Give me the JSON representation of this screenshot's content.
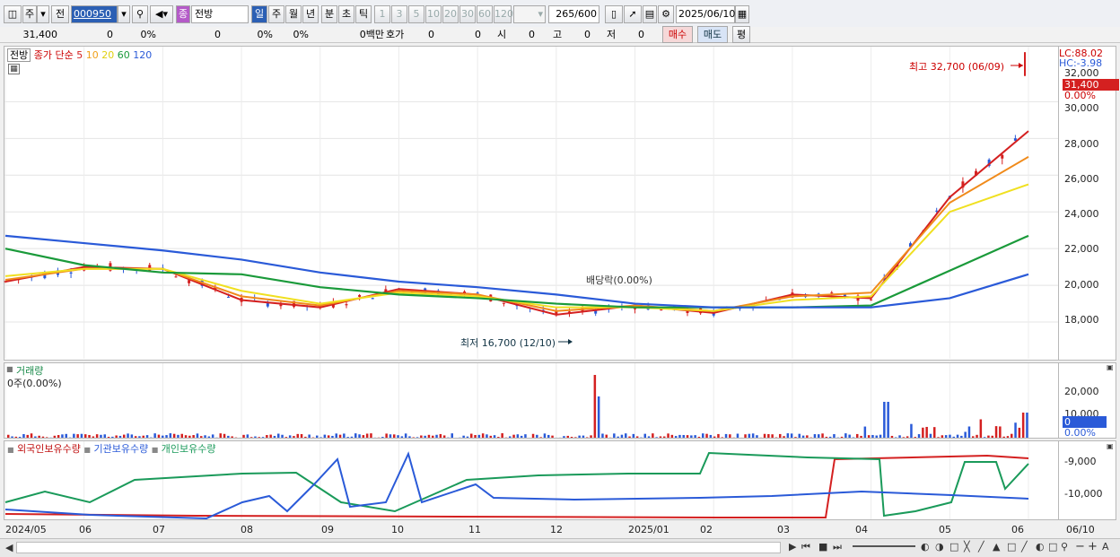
{
  "toolbar": {
    "type_label": "주",
    "prefix_label": "전",
    "code_value": "000950",
    "sector_badge": "종",
    "stock_name": "전방",
    "periods": [
      "일",
      "주",
      "월",
      "년",
      "분",
      "초",
      "틱"
    ],
    "intervals": [
      "1",
      "3",
      "5",
      "10",
      "20",
      "30",
      "60",
      "120"
    ],
    "count_value": "265",
    "count_max": "/600",
    "date_value": "2025/06/10"
  },
  "quote": {
    "price": "31,400",
    "change": "0",
    "change_pct": "0%",
    "volume": "0",
    "volume_pct": "0%",
    "turnover_pct": "0%",
    "amount": "0백만",
    "hoga_label": "호가",
    "hoga1": "0",
    "hoga2": "0",
    "open_label": "시",
    "open_value": "0",
    "high_label": "고",
    "high_value": "0",
    "low_label": "저",
    "low_value": "0",
    "buy_label": "매수",
    "sell_label": "매도",
    "avg_label": "평"
  },
  "price_panel": {
    "name_tag": "전방",
    "ma_label": "종가 단순",
    "ma_periods": [
      "5",
      "10",
      "20",
      "60",
      "120"
    ],
    "ma_colors": [
      "#d42020",
      "#f08a1a",
      "#f0e020",
      "#1a9a3a",
      "#2a5ad8"
    ],
    "lc_label": "LC:88.02",
    "hc_label": "HC:-3.98",
    "max_label": "32,000",
    "current_price": "31,400",
    "current_pct": "0.00%",
    "y_ticks": [
      "30,000",
      "28,000",
      "26,000",
      "24,000",
      "22,000",
      "20,000",
      "18,000"
    ],
    "high_annotation": "최고 32,700 (06/09)",
    "low_annotation": "최저 16,700 (12/10)",
    "dividend_annotation": "배당락(0.00%)"
  },
  "volume_panel": {
    "title": "거래량",
    "value": "0주(0.00%)",
    "y_ticks": [
      "20,000",
      "10,000"
    ],
    "current": "0",
    "current_pct": "0.00%"
  },
  "holding_panel": {
    "legend": [
      "외국인보유수량",
      "기관보유수량",
      "개인보유수량"
    ],
    "legend_colors": [
      "#d42020",
      "#2a5ad8",
      "#1a9a5a"
    ],
    "y_ticks": [
      "-9,000",
      "-10,000"
    ]
  },
  "x_labels": [
    "2024/05",
    "06",
    "07",
    "08",
    "09",
    "10",
    "11",
    "12",
    "2025/01",
    "02",
    "03",
    "04",
    "05",
    "06"
  ],
  "x_right_label": "06/10",
  "chart_data": {
    "type": "line",
    "title": "전방",
    "x": [
      "2024/05",
      "06",
      "07",
      "08",
      "09",
      "10",
      "11",
      "12",
      "2025/01",
      "02",
      "03",
      "04",
      "05",
      "06"
    ],
    "series": [
      {
        "name": "5",
        "values": [
          20200,
          21000,
          20900,
          19200,
          18800,
          19800,
          19500,
          18400,
          18900,
          18500,
          19500,
          19300,
          24800,
          28400
        ]
      },
      {
        "name": "10",
        "values": [
          20300,
          20900,
          20900,
          19400,
          18900,
          19700,
          19500,
          18600,
          18900,
          18600,
          19400,
          19600,
          24500,
          27000
        ]
      },
      {
        "name": "20",
        "values": [
          20500,
          20900,
          20900,
          19700,
          19000,
          19600,
          19400,
          18800,
          18800,
          18600,
          19200,
          19400,
          24000,
          25500
        ]
      },
      {
        "name": "60",
        "values": [
          22000,
          21100,
          20700,
          20600,
          19900,
          19500,
          19300,
          19000,
          18800,
          18800,
          18800,
          18900,
          20800,
          22700
        ]
      },
      {
        "name": "120",
        "values": [
          22700,
          22300,
          21900,
          21400,
          20700,
          20200,
          19900,
          19500,
          19000,
          18800,
          18800,
          18800,
          19300,
          20600
        ]
      }
    ],
    "ylim": [
      16000,
      33000
    ],
    "high": 32700,
    "low": 16700,
    "last_price": 31400
  }
}
